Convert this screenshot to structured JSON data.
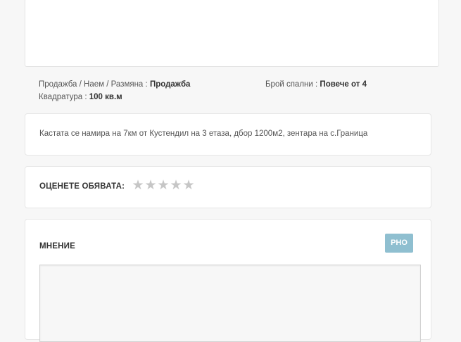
{
  "details": {
    "deal_type_label": "Продажба / Наем / Размяна :",
    "deal_type_value": "Продажба",
    "bedrooms_label": "Брой спални :",
    "bedrooms_value": "Повече от 4",
    "area_label": "Квадратура :",
    "area_value": "100 кв.м"
  },
  "description": {
    "text": "Кастата се намира на 7км от Кустендил на 3 етаза, дбор 1200м2, зентара на с.Границa"
  },
  "rating": {
    "label": "ОЦЕНЕТЕ ОБЯВАТА:",
    "stars": [
      "★",
      "★",
      "★",
      "★",
      "★"
    ],
    "value": 0,
    "max": 5
  },
  "opinion": {
    "title": "МНЕНИЕ",
    "button_label": "РНО",
    "input_value": ""
  },
  "colors": {
    "accent": "#8fbfd0",
    "star_empty": "#c6c6c6"
  }
}
